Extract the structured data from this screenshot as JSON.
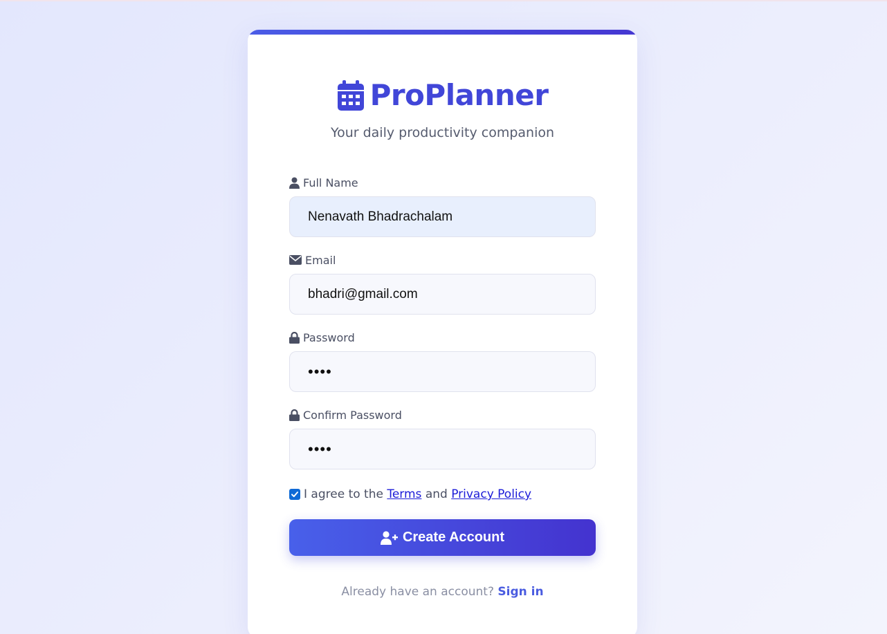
{
  "brand": {
    "name": "ProPlanner",
    "tagline": "Your daily productivity companion"
  },
  "form": {
    "full_name": {
      "label": "Full Name",
      "value": "Nenavath Bhadrachalam"
    },
    "email": {
      "label": "Email",
      "value": "bhadri@gmail.com"
    },
    "password": {
      "label": "Password",
      "value": "abcd"
    },
    "confirm_password": {
      "label": "Confirm Password",
      "value": "abcd"
    },
    "agree": {
      "checked": true,
      "prefix": "I agree to the",
      "terms_link": "Terms",
      "and": "and",
      "privacy_link": "Privacy Policy"
    },
    "submit_label": "Create Account"
  },
  "footer": {
    "prompt": "Already have an account?",
    "signin_link": "Sign in"
  },
  "icons": {
    "brand": "calendar-icon",
    "full_name": "user-icon",
    "email": "envelope-icon",
    "password": "lock-icon",
    "confirm_password": "lock-icon",
    "submit": "user-plus-icon"
  },
  "colors": {
    "brand": "#4146d8",
    "button_start": "#4860ea",
    "button_end": "#4433cf",
    "link": "#1b1bd8",
    "signin_link": "#4a5ce0"
  }
}
